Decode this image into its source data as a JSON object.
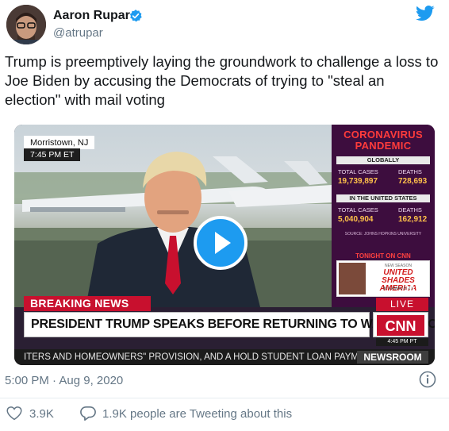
{
  "tweet": {
    "author_name": "Aaron Rupar",
    "handle": "@atrupar",
    "text": "Trump is preemptively laying the groundwork to challenge a loss to Joe Biden by accusing the Democrats of trying to \"steal an election\" with mail voting",
    "timestamp": "5:00 PM · Aug 9, 2020",
    "likes": "3.9K",
    "replies_text": "1.9K people are Tweeting about this"
  },
  "icons": {
    "verified": "verified-badge-icon",
    "logo": "twitter-bird-icon",
    "info": "info-icon",
    "like": "heart-icon",
    "reply": "speech-bubble-icon",
    "play": "play-icon"
  },
  "video": {
    "location": "Morristown, NJ",
    "time": "7:45 PM ET",
    "side_title_1": "CORONAVIRUS",
    "side_title_2": "PANDEMIC",
    "globally_label": "GLOBALLY",
    "global_cases_label": "TOTAL CASES",
    "global_deaths_label": "DEATHS",
    "global_cases": "19,739,897",
    "global_deaths": "728,693",
    "us_label": "IN THE UNITED STATES",
    "us_cases_label": "TOTAL CASES",
    "us_deaths_label": "DEATHS",
    "us_cases": "5,040,904",
    "us_deaths": "162,912",
    "source": "SOURCE: JOHNS HOPKINS UNIVERSITY",
    "tonight": "TONIGHT ON CNN",
    "promo_new": "NEW SEASON",
    "promo_title_1": "UNITED SHADES",
    "promo_title_2": "AMERICA",
    "promo_host": "W. KAMAU BELL",
    "promo_time": "10",
    "breaking": "BREAKING NEWS",
    "live": "LIVE",
    "headline": "PRESIDENT TRUMP SPEAKS BEFORE RETURNING TO WASHINGTON",
    "network": "CNN",
    "clock": "4:45 PM PT",
    "ticker": "ITERS AND HOMEOWNERS\" PROVISION, AND A HOLD STUDENT LOAN PAYME",
    "ticker_label": "NEWSROOM"
  },
  "colors": {
    "twitter_blue": "#1d9bf0",
    "cnn_red": "#c8102e",
    "text_gray": "#657786"
  }
}
